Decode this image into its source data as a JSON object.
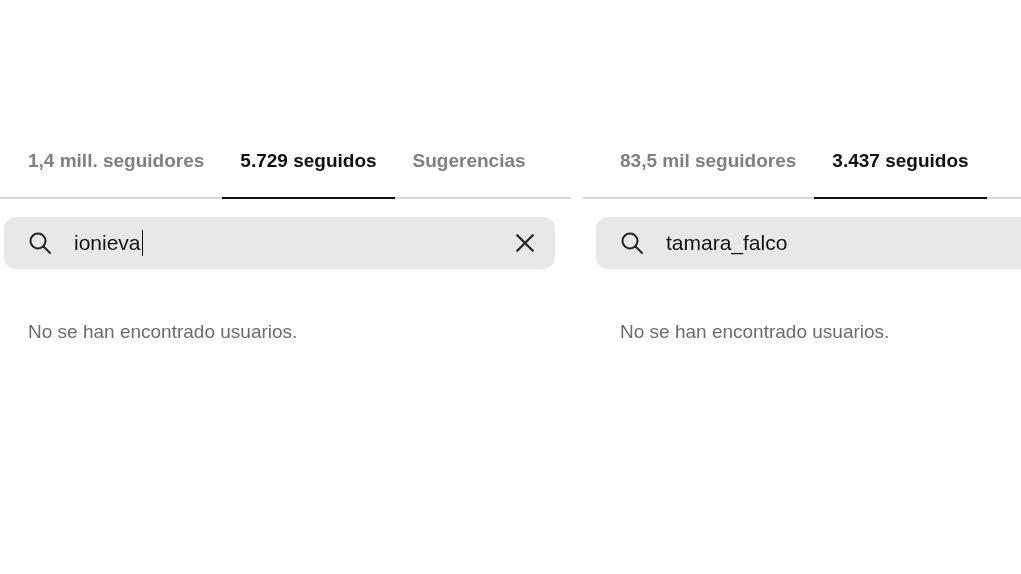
{
  "panels": [
    {
      "tabs": [
        {
          "label": "1,4 mill. seguidores",
          "selected": false
        },
        {
          "label": "5.729 seguidos",
          "selected": true
        },
        {
          "label": "Sugerencias",
          "selected": false
        }
      ],
      "search": {
        "value": "ionieva",
        "cursor": true,
        "clear_button": true
      },
      "message": "No se han encontrado usuarios."
    },
    {
      "tabs": [
        {
          "label": "83,5 mil seguidores",
          "selected": false
        },
        {
          "label": "3.437 seguidos",
          "selected": true
        }
      ],
      "search": {
        "value": "tamara_falco",
        "cursor": false
      },
      "message": "No se han encontrado usuarios."
    }
  ]
}
